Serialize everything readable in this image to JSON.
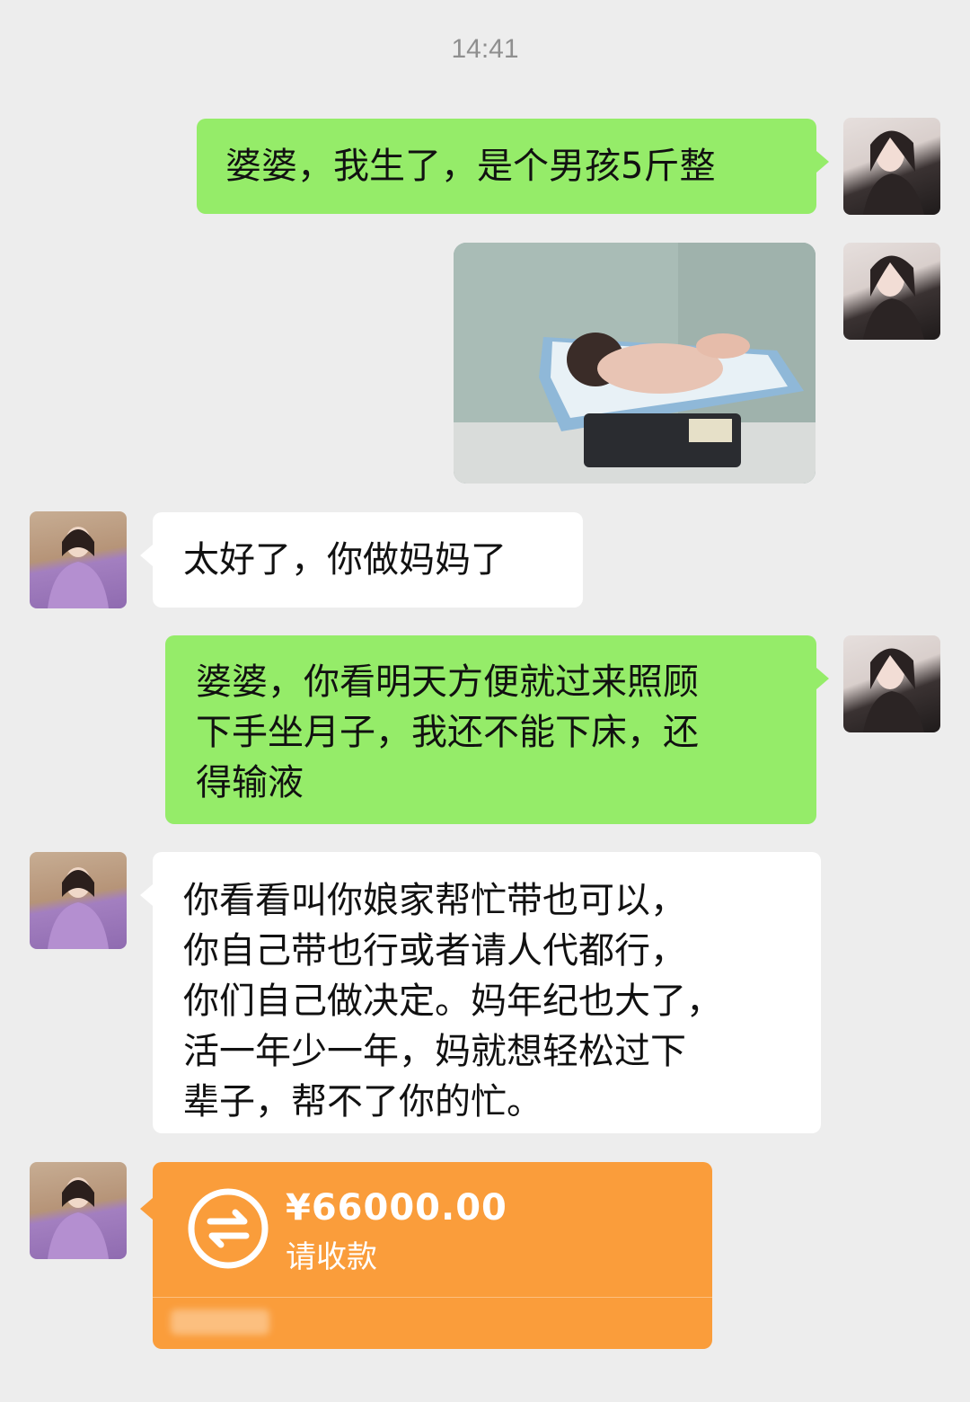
{
  "chat": {
    "timestamp": "14:41",
    "messages": [
      {
        "sender": "me",
        "type": "text",
        "text": "婆婆，我生了，是个男孩5斤整"
      },
      {
        "sender": "me",
        "type": "image",
        "icon": "photo-newborn-on-scale"
      },
      {
        "sender": "mother-in-law",
        "type": "text",
        "text": "太好了，你做妈妈了"
      },
      {
        "sender": "me",
        "type": "text",
        "text": "婆婆，你看明天方便就过来照顾\n下手坐月子，我还不能下床，还\n得输液"
      },
      {
        "sender": "mother-in-law",
        "type": "text",
        "text": "你看看叫你娘家帮忙带也可以，\n你自己带也行或者请人代都行，\n 你们自己做决定。妈年纪也大了，\n活一年少一年，妈就想轻松过下\n辈子，帮不了你的忙。"
      },
      {
        "sender": "mother-in-law",
        "type": "transfer",
        "amount": "¥66000.00",
        "status": "请收款",
        "icon": "transfer-arrows-icon"
      }
    ]
  },
  "colors": {
    "background": "#ededed",
    "my_bubble": "#95ec69",
    "their_bubble": "#ffffff",
    "transfer": "#fa9d3b",
    "timestamp": "#8f8f8f"
  }
}
